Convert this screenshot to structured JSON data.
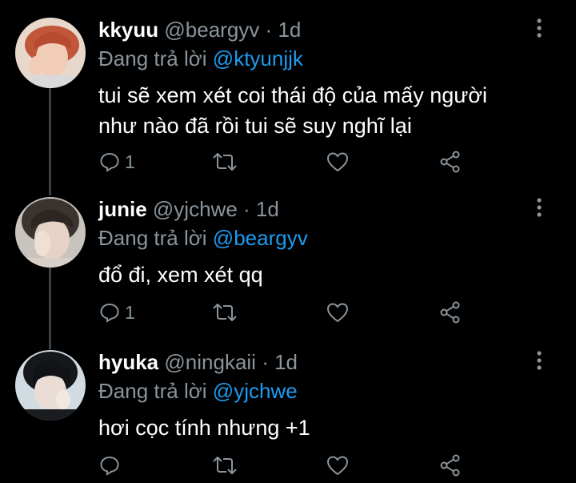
{
  "tweets": [
    {
      "name": "kkyuu",
      "handle": "@beargyv",
      "dot": "·",
      "time": "1d",
      "reply_prefix": "Đang trả lời",
      "reply_to": "@ktyunjjk",
      "lines": [
        "tui sẽ xem xét coi thái độ của mấy người",
        "như nào đã rồi tui sẽ suy nghĩ lại"
      ],
      "reply_count": "1"
    },
    {
      "name": "junie",
      "handle": "@yjchwe",
      "dot": "·",
      "time": "1d",
      "reply_prefix": "Đang trả lời",
      "reply_to": "@beargyv",
      "lines": [
        "đổ đi, xem xét qq"
      ],
      "reply_count": "1"
    },
    {
      "name": "hyuka",
      "handle": "@ningkaii",
      "dot": "·",
      "time": "1d",
      "reply_prefix": "Đang trả lời",
      "reply_to": "@yjchwe",
      "lines": [
        "hơi cọc tính nhưng +1"
      ],
      "reply_count": ""
    }
  ],
  "colors": {
    "background": "#000000",
    "secondary_text": "#8a949c",
    "mention": "#1d9bf0",
    "thread_line": "#3a3f44"
  },
  "icons": [
    "avatar",
    "more-icon",
    "reply-icon",
    "retweet-icon",
    "like-icon",
    "share-icon"
  ]
}
